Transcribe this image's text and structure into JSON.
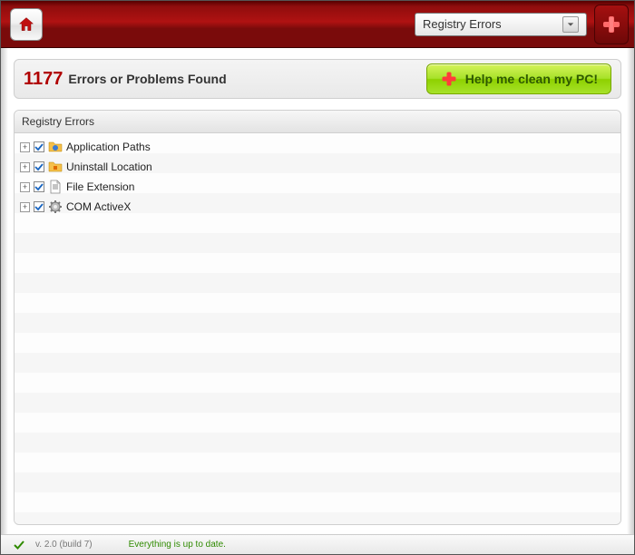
{
  "dropdown": {
    "selected": "Registry Errors"
  },
  "summary": {
    "count": "1177",
    "label": "Errors or Problems Found"
  },
  "help_button": {
    "label": "Help me clean my PC!"
  },
  "panel": {
    "title": "Registry Errors",
    "items": [
      {
        "label": "Application Paths",
        "icon": "folder-blue"
      },
      {
        "label": "Uninstall Location",
        "icon": "folder-orange"
      },
      {
        "label": "File Extension",
        "icon": "file"
      },
      {
        "label": "COM ActiveX",
        "icon": "gear"
      }
    ]
  },
  "status": {
    "version": "v. 2.0 (build 7)",
    "message": "Everything is up to date."
  },
  "colors": {
    "accent_red": "#8f0d0d",
    "error_red": "#b00000",
    "action_green": "#a7e22a",
    "status_green": "#2f8a00"
  }
}
